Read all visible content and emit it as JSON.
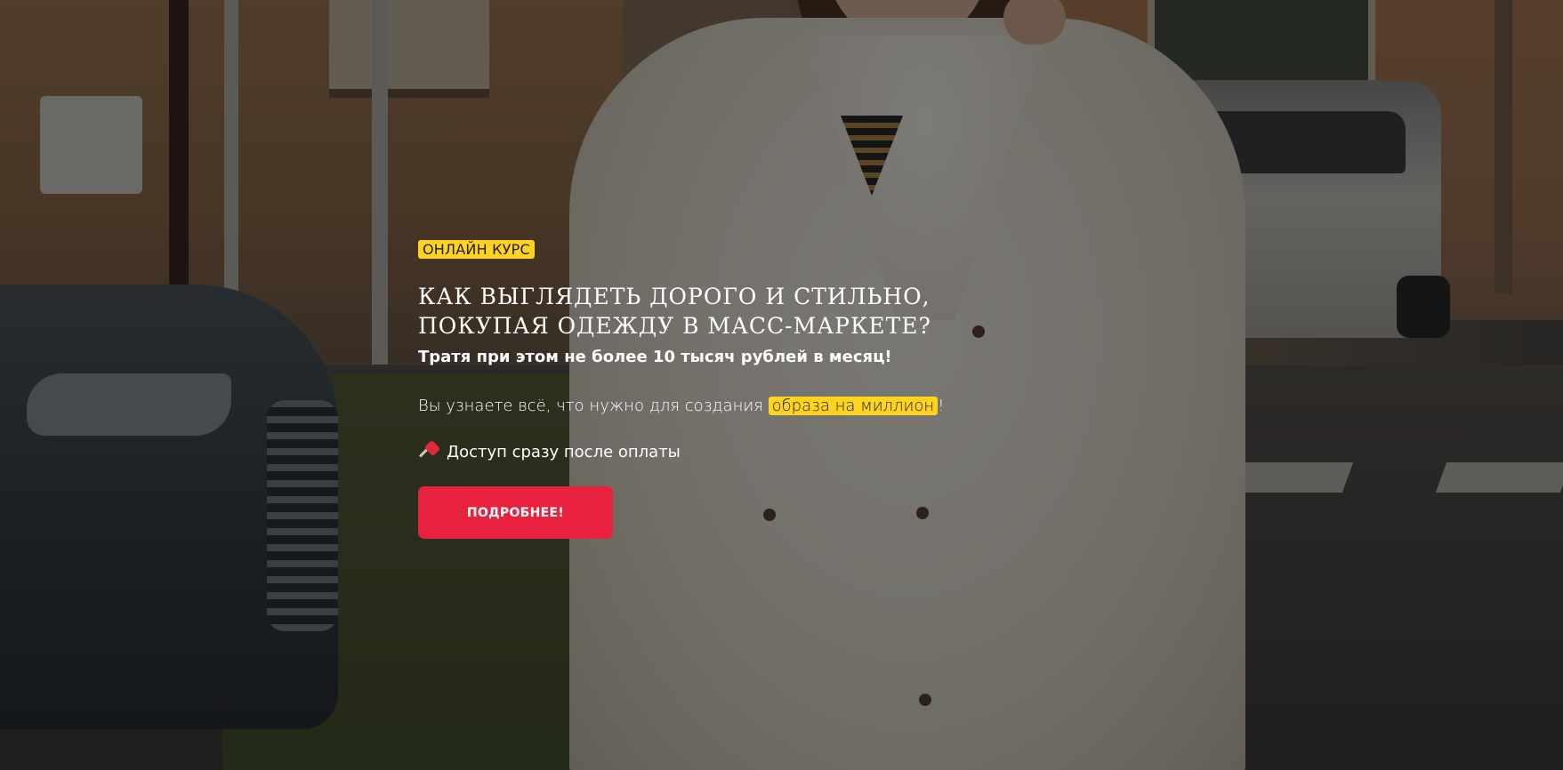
{
  "hero": {
    "badge": "ОНЛАЙН КУРС",
    "title_line1": "КАК ВЫГЛЯДЕТЬ ДОРОГО И СТИЛЬНО,",
    "title_line2": "ПОКУПАЯ ОДЕЖДУ В МАСС-МАРКЕТЕ?",
    "subtitle": "Тратя при этом не более 10 тысяч рублей в месяц!",
    "desc_before": "Вы узнаете всё, что нужно для создания ",
    "desc_highlight": "образа на миллион",
    "desc_after": "!",
    "access_icon": "pushpin-icon",
    "access_text": "Доступ сразу после оплаты",
    "button_label": "ПОДРОБНЕЕ!"
  },
  "colors": {
    "accent_yellow": "#ffd31f",
    "button_red": "#e8213f",
    "overlay": "rgba(0,0,0,0.5)"
  }
}
